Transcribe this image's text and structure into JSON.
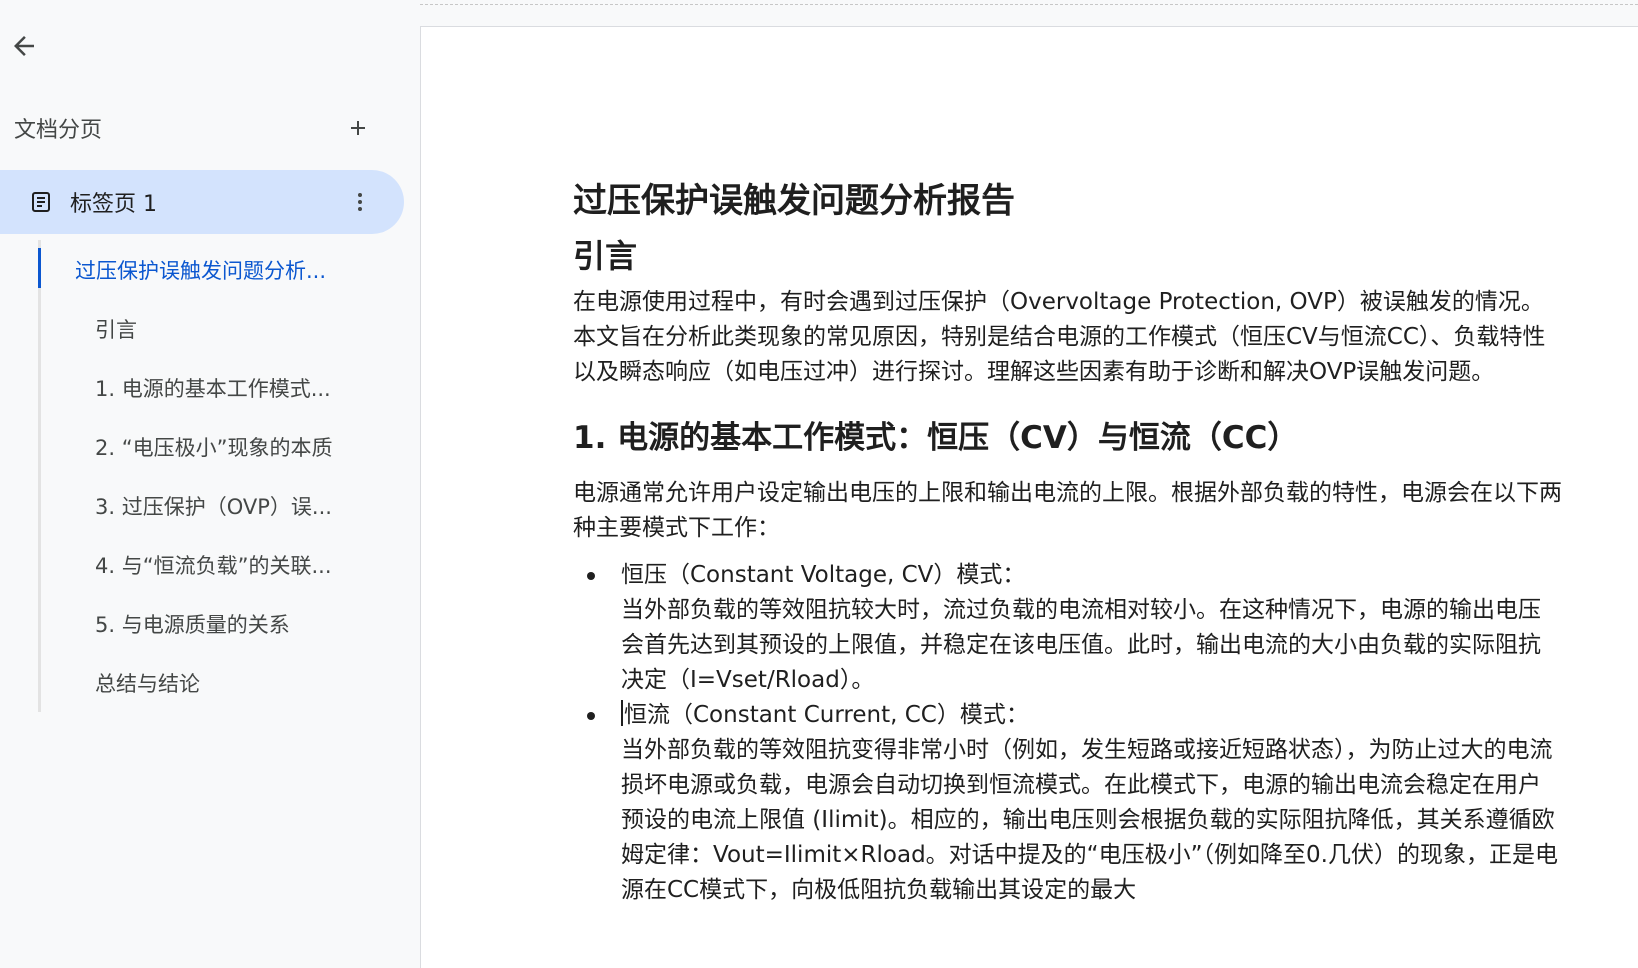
{
  "sidebar": {
    "section_title": "文档分页",
    "tab": {
      "label": "标签页 1"
    },
    "outline": [
      {
        "label": "过压保护误触发问题分析...",
        "active": true
      },
      {
        "label": "引言"
      },
      {
        "label": "1. 电源的基本工作模式..."
      },
      {
        "label": "2. “电压极小”现象的本质"
      },
      {
        "label": "3. 过压保护（OVP）误..."
      },
      {
        "label": "4. 与“恒流负载”的关联..."
      },
      {
        "label": "5. 与电源质量的关系"
      },
      {
        "label": "总结与结论"
      }
    ]
  },
  "doc": {
    "title": "过压保护误触发问题分析报告",
    "intro_heading": "引言",
    "intro_text": "在电源使用过程中，有时会遇到过压保护（Overvoltage Protection, OVP）被误触发的情况。本文旨在分析此类现象的常见原因，特别是结合电源的工作模式（恒压CV与恒流CC）、负载特性以及瞬态响应（如电压过冲）进行探讨。理解这些因素有助于诊断和解决OVP误触发问题。",
    "section1_heading": "1. 电源的基本工作模式：恒压（CV）与恒流（CC）",
    "section1_text": "电源通常允许用户设定输出电压的上限和输出电流的上限。根据外部负载的特性，电源会在以下两种主要模式下工作：",
    "bullets": [
      {
        "title": "恒压（Constant Voltage, CV）模式：",
        "body": "当外部负载的等效阻抗较大时，流过负载的电流相对较小。在这种情况下，电源的输出电压会首先达到其预设的上限值，并稳定在该电压值。此时，输出电流的大小由负载的实际阻抗决定（I=Vset/Rload）。"
      },
      {
        "title": "恒流（Constant Current, CC）模式：",
        "body": "当外部负载的等效阻抗变得非常小时（例如，发生短路或接近短路状态），为防止过大的电流损坏电源或负载，电源会自动切换到恒流模式。在此模式下，电源的输出电流会稳定在用户预设的电流上限值 (Ilimit)。相应的，输出电压则会根据负载的实际阻抗降低，其关系遵循欧姆定律：Vout=Ilimit×Rload。对话中提及的“电压极小”（例如降至0.几伏）的现象，正是电源在CC模式下，向极低阻抗负载输出其设定的最大"
      }
    ]
  }
}
